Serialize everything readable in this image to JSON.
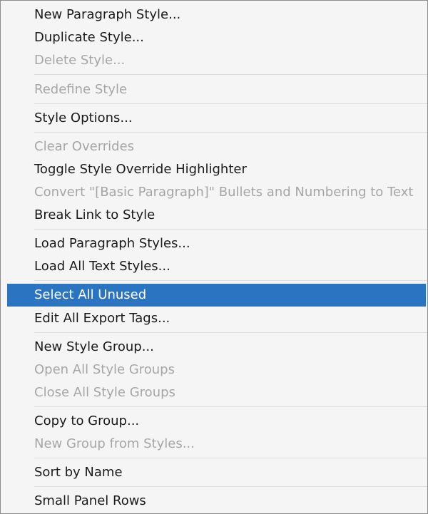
{
  "menu": {
    "items": [
      {
        "label": "New Paragraph Style...",
        "enabled": true
      },
      {
        "label": "Duplicate Style...",
        "enabled": true
      },
      {
        "label": "Delete Style...",
        "enabled": false
      },
      {
        "label": "Redefine Style",
        "enabled": false
      },
      {
        "label": "Style Options...",
        "enabled": true
      },
      {
        "label": "Clear Overrides",
        "enabled": false
      },
      {
        "label": "Toggle Style Override Highlighter",
        "enabled": true
      },
      {
        "label": "Convert \"[Basic Paragraph]\" Bullets and Numbering to Text",
        "enabled": false
      },
      {
        "label": "Break Link to Style",
        "enabled": true
      },
      {
        "label": "Load Paragraph Styles...",
        "enabled": true
      },
      {
        "label": "Load All Text Styles...",
        "enabled": true
      },
      {
        "label": "Select All Unused",
        "enabled": true,
        "selected": true
      },
      {
        "label": "Edit All Export Tags...",
        "enabled": true
      },
      {
        "label": "New Style Group...",
        "enabled": true
      },
      {
        "label": "Open All Style Groups",
        "enabled": false
      },
      {
        "label": "Close All Style Groups",
        "enabled": false
      },
      {
        "label": "Copy to Group...",
        "enabled": true
      },
      {
        "label": "New Group from Styles...",
        "enabled": false
      },
      {
        "label": "Sort by Name",
        "enabled": true
      },
      {
        "label": "Small Panel Rows",
        "enabled": true
      }
    ]
  },
  "colors": {
    "background": "#f5f5f5",
    "text": "#1a1a1a",
    "disabled_text": "#a6a6a6",
    "highlight": "#2b74c2",
    "separator": "#dedede"
  }
}
